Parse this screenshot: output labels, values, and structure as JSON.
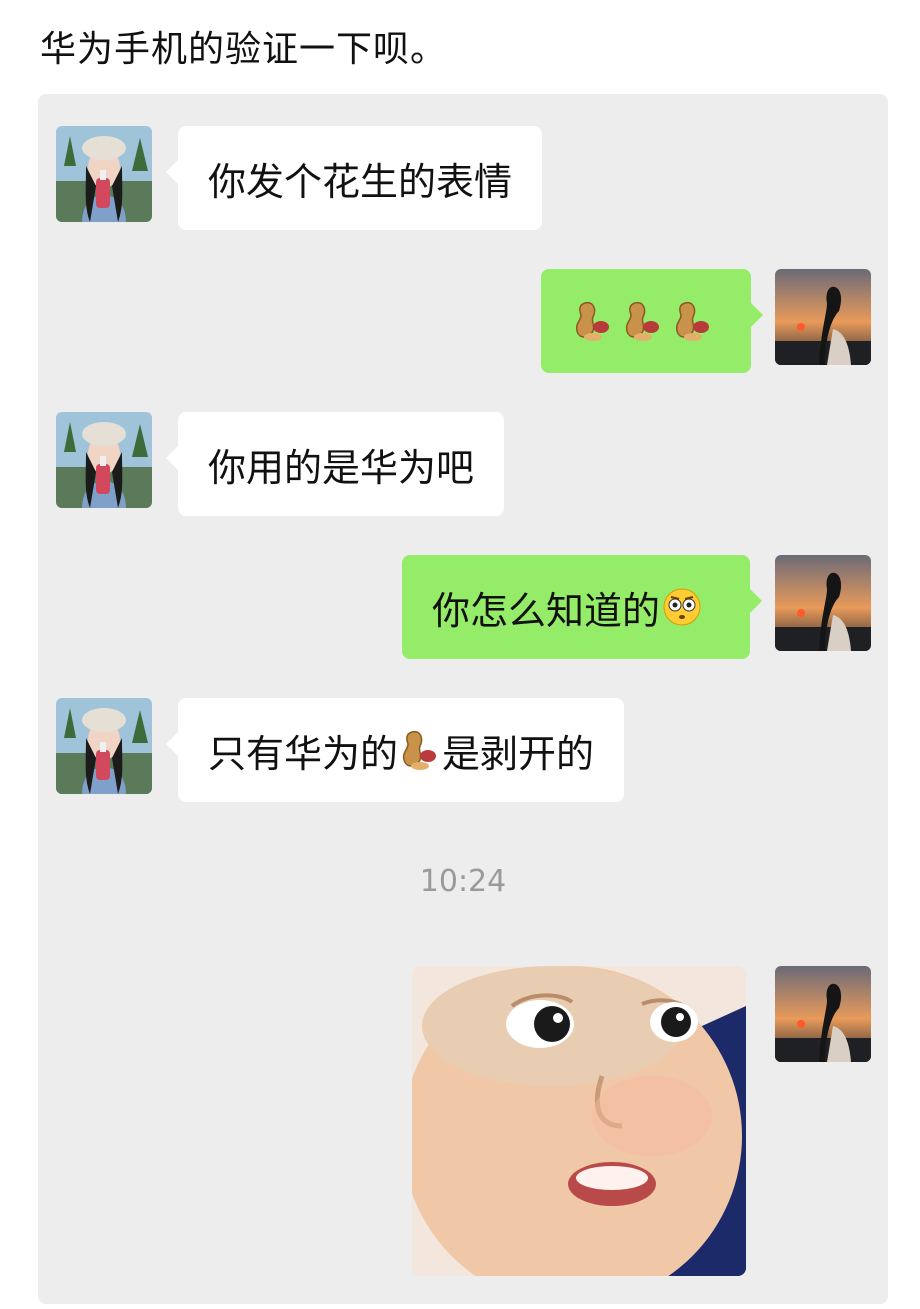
{
  "caption": "华为手机的验证一下呗。",
  "messages": [
    {
      "side": "in",
      "text": "你发个花生的表情"
    },
    {
      "side": "out",
      "emoji": [
        "peanut-icon",
        "peanut-icon",
        "peanut-icon"
      ]
    },
    {
      "side": "in",
      "text": "你用的是华为吧"
    },
    {
      "side": "out",
      "text": "你怎么知道的",
      "suffix_icon": "flushed-face-icon"
    },
    {
      "side": "in",
      "text_before": "只有华为的",
      "inline_icon": "peanut-icon",
      "text_after": "是剥开的"
    }
  ],
  "timestamp": "10:24",
  "sticker": {
    "icon": "surprised-baby-sticker"
  },
  "colors": {
    "chat_background": "#ededed",
    "incoming_bubble": "#ffffff",
    "outgoing_bubble": "#95ec69",
    "timestamp_text": "#9a9a9a"
  }
}
